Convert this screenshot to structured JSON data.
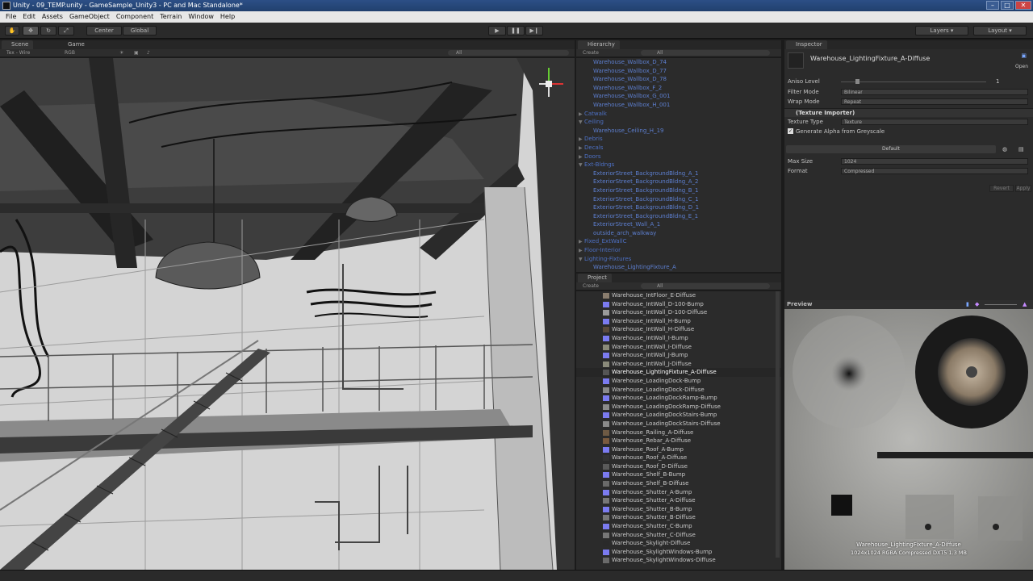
{
  "window": {
    "title": "Unity - 09_TEMP.unity - GameSample_Unity3 - PC and Mac Standalone*"
  },
  "menu": [
    "File",
    "Edit",
    "Assets",
    "GameObject",
    "Component",
    "Terrain",
    "Window",
    "Help"
  ],
  "toolbar": {
    "pivot": "Center",
    "space": "Global",
    "layers": "Layers",
    "layout": "Layout"
  },
  "scene_view": {
    "tab_scene": "Scene",
    "tab_game": "Game",
    "render_mode": "Tex - Wire",
    "color_mode": "RGB",
    "search": "All"
  },
  "hierarchy": {
    "tab": "Hierarchy",
    "create": "Create",
    "search": "All",
    "rows": [
      {
        "label": "Warehouse_Wallbox_D_74",
        "indent": 2
      },
      {
        "label": "Warehouse_Wallbox_D_77",
        "indent": 2
      },
      {
        "label": "Warehouse_Wallbox_D_78",
        "indent": 2
      },
      {
        "label": "Warehouse_Wallbox_F_2",
        "indent": 2
      },
      {
        "label": "Warehouse_Wallbox_G_001",
        "indent": 2
      },
      {
        "label": "Warehouse_Wallbox_H_001",
        "indent": 2
      },
      {
        "label": "Catwalk",
        "indent": 1,
        "arrow": "▶"
      },
      {
        "label": "Ceiling",
        "indent": 1,
        "arrow": "▼"
      },
      {
        "label": "Warehouse_Ceiling_H_19",
        "indent": 2
      },
      {
        "label": "Debris",
        "indent": 1,
        "arrow": "▶"
      },
      {
        "label": "Decals",
        "indent": 1,
        "arrow": "▶"
      },
      {
        "label": "Doors",
        "indent": 1,
        "arrow": "▶"
      },
      {
        "label": "Ext-Bldngs",
        "indent": 1,
        "arrow": "▼"
      },
      {
        "label": "ExteriorStreet_BackgroundBldng_A_1",
        "indent": 2
      },
      {
        "label": "ExteriorStreet_BackgroundBldng_A_2",
        "indent": 2
      },
      {
        "label": "ExteriorStreet_BackgroundBldng_B_1",
        "indent": 2
      },
      {
        "label": "ExteriorStreet_BackgroundBldng_C_1",
        "indent": 2
      },
      {
        "label": "ExteriorStreet_BackgroundBldng_D_1",
        "indent": 2
      },
      {
        "label": "ExteriorStreet_BackgroundBldng_E_1",
        "indent": 2
      },
      {
        "label": "ExteriorStreet_Wall_A_1",
        "indent": 2
      },
      {
        "label": "outside_arch_walkway",
        "indent": 2
      },
      {
        "label": "Fixed_ExtWallC",
        "indent": 1,
        "arrow": "▶"
      },
      {
        "label": "Floor-Interior",
        "indent": 1,
        "arrow": "▶"
      },
      {
        "label": "Lighting-Fixtures",
        "indent": 1,
        "arrow": "▼"
      },
      {
        "label": "Warehouse_LightingFixture_A",
        "indent": 2
      }
    ]
  },
  "project": {
    "tab": "Project",
    "create": "Create",
    "search": "All",
    "rows": [
      {
        "label": "Warehouse_IntFloor_E-Diffuse",
        "color": "#8a7d6e"
      },
      {
        "label": "Warehouse_IntWall_D-100-Bump",
        "color": "#7b7bf0"
      },
      {
        "label": "Warehouse_IntWall_D-100-Diffuse",
        "color": "#9a9a9a"
      },
      {
        "label": "Warehouse_IntWall_H-Bump",
        "color": "#7b7bf0"
      },
      {
        "label": "Warehouse_IntWall_H-Diffuse",
        "color": "#5a4a3a"
      },
      {
        "label": "Warehouse_IntWall_I-Bump",
        "color": "#7b7bf0"
      },
      {
        "label": "Warehouse_IntWall_I-Diffuse",
        "color": "#8a8a7a"
      },
      {
        "label": "Warehouse_IntWall_J-Bump",
        "color": "#7b7bf0"
      },
      {
        "label": "Warehouse_IntWall_J-Diffuse",
        "color": "#8a8a7a"
      },
      {
        "label": "Warehouse_LightingFixture_A-Diffuse",
        "color": "#555555",
        "selected": true
      },
      {
        "label": "Warehouse_LoadingDock-Bump",
        "color": "#7b7bf0"
      },
      {
        "label": "Warehouse_LoadingDock-Diffuse",
        "color": "#8a8a8a"
      },
      {
        "label": "Warehouse_LoadingDockRamp-Bump",
        "color": "#7b7bf0"
      },
      {
        "label": "Warehouse_LoadingDockRamp-Diffuse",
        "color": "#8a8a8a"
      },
      {
        "label": "Warehouse_LoadingDockStairs-Bump",
        "color": "#7b7bf0"
      },
      {
        "label": "Warehouse_LoadingDockStairs-Diffuse",
        "color": "#8a8a8a"
      },
      {
        "label": "Warehouse_Railing_A-Diffuse",
        "color": "#6e5a44"
      },
      {
        "label": "Warehouse_Rebar_A-Diffuse",
        "color": "#7a5a3e"
      },
      {
        "label": "Warehouse_Roof_A-Bump",
        "color": "#7b7bf0"
      },
      {
        "label": "Warehouse_Roof_A-Diffuse",
        "color": "#333333"
      },
      {
        "label": "Warehouse_Roof_D-Diffuse",
        "color": "#5a5a5a"
      },
      {
        "label": "Warehouse_Shelf_B-Bump",
        "color": "#7b7bf0"
      },
      {
        "label": "Warehouse_Shelf_B-Diffuse",
        "color": "#6a6a6a"
      },
      {
        "label": "Warehouse_Shutter_A-Bump",
        "color": "#7b7bf0"
      },
      {
        "label": "Warehouse_Shutter_A-Diffuse",
        "color": "#777777"
      },
      {
        "label": "Warehouse_Shutter_B-Bump",
        "color": "#7b7bf0"
      },
      {
        "label": "Warehouse_Shutter_B-Diffuse",
        "color": "#777777"
      },
      {
        "label": "Warehouse_Shutter_C-Bump",
        "color": "#7b7bf0"
      },
      {
        "label": "Warehouse_Shutter_C-Diffuse",
        "color": "#777777"
      },
      {
        "label": "Warehouse_Skylight-Diffuse",
        "color": "#2a2a2a"
      },
      {
        "label": "Warehouse_SkylightWindows-Bump",
        "color": "#7b7bf0"
      },
      {
        "label": "Warehouse_SkylightWindows-Diffuse",
        "color": "#6a6a6a"
      }
    ]
  },
  "inspector": {
    "tab": "Inspector",
    "asset_name": "Warehouse_LightingFixture_A-Diffuse",
    "open_label": "Open",
    "aniso_label": "Aniso Level",
    "aniso_value": "1",
    "filter_label": "Filter Mode",
    "filter_value": "Bilinear",
    "wrap_label": "Wrap Mode",
    "wrap_value": "Repeat",
    "importer_label": "(Texture Importer)",
    "texture_type_label": "Texture Type",
    "texture_type_value": "Texture",
    "alpha_label": "Generate Alpha from Greyscale",
    "platform_label": "Default",
    "maxsize_label": "Max Size",
    "maxsize_value": "1024",
    "format_label": "Format",
    "format_value": "Compressed",
    "revert_label": "Revert",
    "apply_label": "Apply"
  },
  "preview": {
    "header": "Preview",
    "name": "Warehouse_LightingFixture_A-Diffuse",
    "info": "1024x1024  RGBA Compressed DXT5   1.3 MB"
  },
  "colors": {
    "link_blue": "#5d7fd0",
    "panel_bg": "#2b2b2b",
    "titlebar": "#2c4f86"
  }
}
